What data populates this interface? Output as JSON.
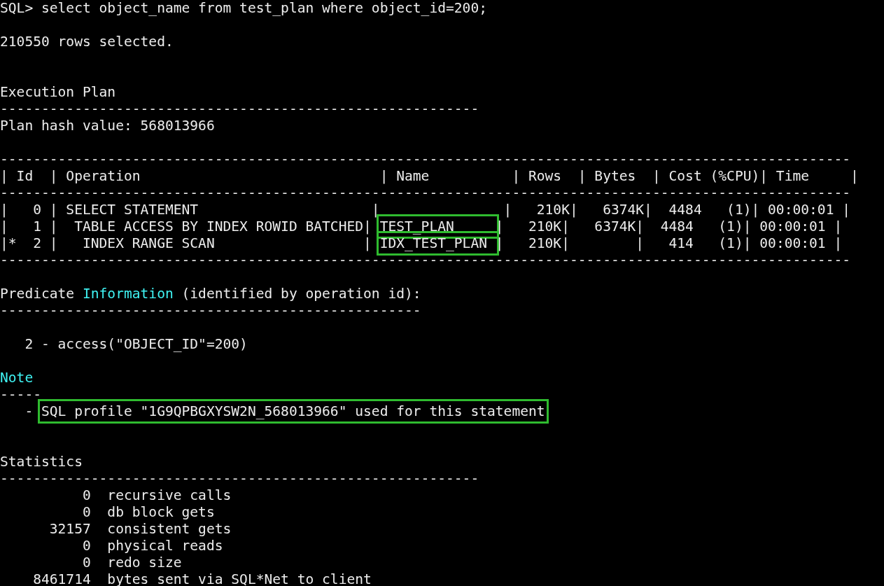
{
  "terminal": {
    "lines": [
      {
        "kind": "text",
        "segments": [
          {
            "kind": "plain",
            "text": "SQL> select object_name from test_plan where object_id=200;"
          }
        ]
      },
      {
        "kind": "blank"
      },
      {
        "kind": "text",
        "segments": [
          {
            "kind": "plain",
            "text": "210550 rows selected."
          }
        ]
      },
      {
        "kind": "blank"
      },
      {
        "kind": "blank"
      },
      {
        "kind": "text",
        "segments": [
          {
            "kind": "plain",
            "text": "Execution Plan"
          }
        ]
      },
      {
        "kind": "rule",
        "segments": [
          {
            "kind": "plain",
            "text": "----------------------------------------------------------"
          }
        ]
      },
      {
        "kind": "text",
        "segments": [
          {
            "kind": "plain",
            "text": "Plan hash value: 568013966"
          }
        ]
      },
      {
        "kind": "blank"
      },
      {
        "kind": "rule",
        "segments": [
          {
            "kind": "plain",
            "text": "-------------------------------------------------------------------------------------------------------"
          }
        ]
      },
      {
        "kind": "text",
        "segments": [
          {
            "kind": "plain",
            "text": "| Id  | Operation                             | Name          | Rows  | Bytes  | Cost (%CPU)| Time     |"
          }
        ]
      },
      {
        "kind": "rule",
        "segments": [
          {
            "kind": "plain",
            "text": "-------------------------------------------------------------------------------------------------------"
          }
        ]
      },
      {
        "kind": "text",
        "segments": [
          {
            "kind": "plain",
            "text": "|   0 | SELECT STATEMENT                     |               |   210K|   6374K|  4484   (1)| 00:00:01 |"
          }
        ]
      },
      {
        "kind": "text",
        "segments": [
          {
            "kind": "plain",
            "text": "|   1 |  TABLE ACCESS BY INDEX ROWID BATCHED| "
          },
          {
            "kind": "boxed",
            "text": "TEST_PLAN     "
          },
          {
            "kind": "plain",
            "text": "|   210K|   6374K|  4484   (1)| 00:00:01 |"
          }
        ]
      },
      {
        "kind": "text",
        "segments": [
          {
            "kind": "plain",
            "text": "|*  2 |   INDEX RANGE SCAN                  | "
          },
          {
            "kind": "boxed",
            "text": "IDX_TEST_PLAN "
          },
          {
            "kind": "plain",
            "text": "|   210K|        |   414   (1)| 00:00:01 |"
          }
        ]
      },
      {
        "kind": "rule",
        "segments": [
          {
            "kind": "plain",
            "text": "-------------------------------------------------------------------------------------------------------"
          }
        ]
      },
      {
        "kind": "blank"
      },
      {
        "kind": "text",
        "segments": [
          {
            "kind": "plain",
            "text": "Predicate "
          },
          {
            "kind": "keyword",
            "text": "Information"
          },
          {
            "kind": "plain",
            "text": " (identified by operation id):"
          }
        ]
      },
      {
        "kind": "rule",
        "segments": [
          {
            "kind": "plain",
            "text": "---------------------------------------------------"
          }
        ]
      },
      {
        "kind": "blank"
      },
      {
        "kind": "text",
        "segments": [
          {
            "kind": "plain",
            "text": "   2 - access(\"OBJECT_ID\"=200)"
          }
        ]
      },
      {
        "kind": "blank"
      },
      {
        "kind": "text",
        "segments": [
          {
            "kind": "keyword",
            "text": "Note"
          }
        ]
      },
      {
        "kind": "rule",
        "segments": [
          {
            "kind": "plain",
            "text": "-----"
          }
        ]
      },
      {
        "kind": "text",
        "segments": [
          {
            "kind": "plain",
            "text": "   - "
          },
          {
            "kind": "boxed",
            "text": "SQL profile \"1G9QPBGXYSW2N_568013966\" used for this statement"
          }
        ]
      },
      {
        "kind": "blank"
      },
      {
        "kind": "blank"
      },
      {
        "kind": "text",
        "segments": [
          {
            "kind": "plain",
            "text": "Statistics"
          }
        ]
      },
      {
        "kind": "rule",
        "segments": [
          {
            "kind": "plain",
            "text": "----------------------------------------------------------"
          }
        ]
      },
      {
        "kind": "text",
        "segments": [
          {
            "kind": "plain",
            "text": "          0  recursive calls"
          }
        ]
      },
      {
        "kind": "text",
        "segments": [
          {
            "kind": "plain",
            "text": "          0  db block gets"
          }
        ]
      },
      {
        "kind": "text",
        "segments": [
          {
            "kind": "plain",
            "text": "      32157  consistent gets"
          }
        ]
      },
      {
        "kind": "text",
        "segments": [
          {
            "kind": "plain",
            "text": "          0  physical reads"
          }
        ]
      },
      {
        "kind": "text",
        "segments": [
          {
            "kind": "plain",
            "text": "          0  redo size"
          }
        ]
      },
      {
        "kind": "text",
        "segments": [
          {
            "kind": "plain",
            "text": "    8461714  bytes sent via SQL*Net to client"
          }
        ]
      }
    ]
  }
}
